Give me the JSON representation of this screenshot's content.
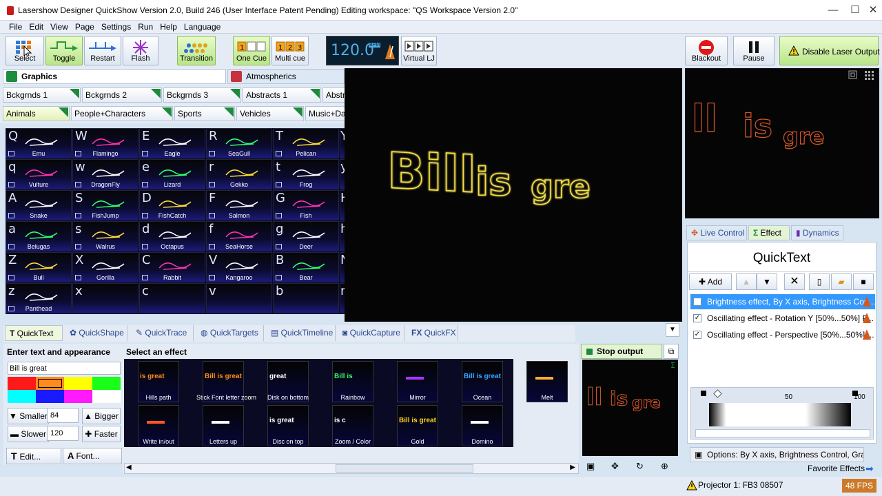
{
  "window": {
    "title": "Lasershow Designer QuickShow   Version 2.0, Build 246   (User Interface Patent Pending)   Editing workspace: \"QS Workspace Version 2.0\"",
    "controls": [
      "—",
      "☐",
      "✕"
    ]
  },
  "menu": [
    "File",
    "Edit",
    "View",
    "Page",
    "Settings",
    "Run",
    "Help",
    "Language"
  ],
  "toolbar": {
    "select": "Select",
    "toggle": "Toggle",
    "restart": "Restart",
    "flash": "Flash",
    "transition": "Transition",
    "one_cue": "One Cue",
    "multi_cue": "Multi cue",
    "bpm": "120.0",
    "bpm_unit": "BPM",
    "virtual_lj": "Virtual LJ",
    "blackout": "Blackout",
    "pause": "Pause",
    "disable_laser": "Disable Laser Output"
  },
  "categories": [
    {
      "label": "Graphics",
      "color": "#1e8c3f"
    },
    {
      "label": "Atmospherics",
      "color": "#c8323c"
    }
  ],
  "group_tabs_row1": [
    "Bckgrnds 1",
    "Bckgrnds 2",
    "Bckgrnds 3",
    "Abstracts 1",
    "Abstra"
  ],
  "group_tabs_row2": [
    "Animals",
    "People+Characters",
    "Sports",
    "Vehicles",
    "Music+Dan"
  ],
  "cues": [
    [
      {
        "k": "Q",
        "n": "Emu"
      },
      {
        "k": "W",
        "n": "Flamingo"
      },
      {
        "k": "E",
        "n": "Eagle"
      },
      {
        "k": "R",
        "n": "SeaGull"
      },
      {
        "k": "T",
        "n": "Pelican"
      }
    ],
    [
      {
        "k": "q",
        "n": "Vulture"
      },
      {
        "k": "w",
        "n": "DragonFly"
      },
      {
        "k": "e",
        "n": "Lizard"
      },
      {
        "k": "r",
        "n": "Gekko"
      },
      {
        "k": "t",
        "n": "Frog"
      }
    ],
    [
      {
        "k": "A",
        "n": "Snake"
      },
      {
        "k": "S",
        "n": "FishJump"
      },
      {
        "k": "D",
        "n": "FishCatch"
      },
      {
        "k": "F",
        "n": "Salmon"
      },
      {
        "k": "G",
        "n": "Fish"
      }
    ],
    [
      {
        "k": "a",
        "n": "Belugas"
      },
      {
        "k": "s",
        "n": "Walrus"
      },
      {
        "k": "d",
        "n": "Octapus"
      },
      {
        "k": "f",
        "n": "SeaHorse"
      },
      {
        "k": "g",
        "n": "Deer"
      }
    ],
    [
      {
        "k": "Z",
        "n": "Bull"
      },
      {
        "k": "X",
        "n": "Gorilla"
      },
      {
        "k": "C",
        "n": "Rabbit"
      },
      {
        "k": "V",
        "n": "Kangaroo"
      },
      {
        "k": "B",
        "n": "Bear"
      }
    ],
    [
      {
        "k": "z",
        "n": "Panthead"
      },
      {
        "k": "x",
        "n": ""
      },
      {
        "k": "c",
        "n": ""
      },
      {
        "k": "v",
        "n": ""
      },
      {
        "k": "b",
        "n": ""
      }
    ]
  ],
  "right_keys": [
    "Y",
    "y",
    "H",
    "h",
    "N",
    "n"
  ],
  "preview_text": {
    "part1": "Bill",
    "part2": "is",
    "part3": "gre"
  },
  "bottom_tabs": [
    "QuickText",
    "QuickShape",
    "QuickTrace",
    "QuickTargets",
    "QuickTimeline",
    "QuickCapture",
    "QuickFX"
  ],
  "quicktext": {
    "header": "Enter text and appearance",
    "text_value": "Bill is great",
    "colors": [
      "#ff1a1a",
      "#ff8c1a",
      "#ffff00",
      "#1aff1a",
      "#00ffff",
      "#1a1aff",
      "#ff1aff",
      "#ffffff"
    ],
    "smaller": "Smaller",
    "size_value": "84",
    "bigger": "Bigger",
    "slower": "Slower",
    "speed_value": "120",
    "faster": "Faster",
    "edit": "Edit...",
    "font": "Font..."
  },
  "effects": {
    "header": "Select an effect",
    "items": [
      {
        "n": "Hills path",
        "t": "is great",
        "c": "#ff8c1a"
      },
      {
        "n": "Stick Font letter zoom",
        "t": "Bill is great",
        "c": "#ff8c1a"
      },
      {
        "n": "Disk on bottom",
        "t": "great",
        "c": "#ffffff"
      },
      {
        "n": "Rainbow",
        "t": "Bill is",
        "c": "#33ff66"
      },
      {
        "n": "Mirror",
        "t": "",
        "c": "#aa33ff"
      },
      {
        "n": "Ocean",
        "t": "Bill is great",
        "c": "#33aaff"
      },
      {
        "n": "Melt",
        "t": "",
        "c": "#ffaa33"
      },
      {
        "n": "Write in/out",
        "t": "",
        "c": "#ff5522"
      },
      {
        "n": "Letters up",
        "t": "",
        "c": "#ffffff"
      },
      {
        "n": "Disc on top",
        "t": "is great",
        "c": "#ffffff"
      },
      {
        "n": "Zoom / Color",
        "t": "is c",
        "c": "#ffffff"
      },
      {
        "n": "Gold",
        "t": "Bill is great",
        "c": "#ffd21a"
      },
      {
        "n": "Domino",
        "t": "",
        "c": "#ffffff"
      }
    ]
  },
  "stop_output": "Stop output",
  "right_tabs": [
    "Live Control",
    "Effect",
    "Dynamics"
  ],
  "qt_panel": {
    "title": "QuickText",
    "add": "Add",
    "effect_list": [
      {
        "label": "Brightness effect, By X axis, Brightness Con...",
        "checked": true,
        "selected": true
      },
      {
        "label": "Oscillating effect - Rotation Y [50%...50%] P...",
        "checked": true,
        "selected": false
      },
      {
        "label": "Oscillating effect - Perspective [50%...50%] ...",
        "checked": true,
        "selected": false
      }
    ],
    "scale_mid": "50",
    "scale_end": "100",
    "options": "Options: By X axis, Brightness Control, Gradient"
  },
  "favorite_effects": "Favorite Effects",
  "status": {
    "projector": "Projector 1: FB3 08507",
    "fps": "48 FPS"
  }
}
